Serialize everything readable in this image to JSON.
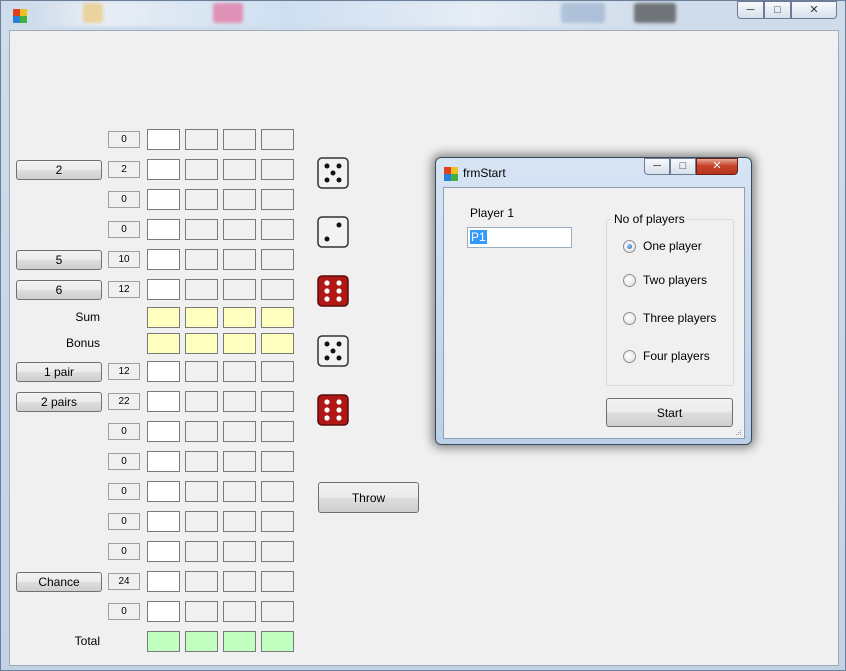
{
  "main": {
    "app_icon": "app-icon",
    "controls": {
      "minimize": "minimize-icon",
      "maximize": "maximize-icon",
      "close": "close-icon"
    }
  },
  "scorecard": {
    "rows": [
      {
        "button": null,
        "label": null,
        "value": "0",
        "cell_style": "plain"
      },
      {
        "button": "2",
        "label": null,
        "value": "2",
        "cell_style": "plain"
      },
      {
        "button": null,
        "label": null,
        "value": "0",
        "cell_style": "plain"
      },
      {
        "button": null,
        "label": null,
        "value": "0",
        "cell_style": "plain"
      },
      {
        "button": "5",
        "label": null,
        "value": "10",
        "cell_style": "plain"
      },
      {
        "button": "6",
        "label": null,
        "value": "12",
        "cell_style": "plain"
      },
      {
        "button": null,
        "label": "Sum",
        "value": null,
        "cell_style": "yellow"
      },
      {
        "button": null,
        "label": "Bonus",
        "value": null,
        "cell_style": "yellow"
      },
      {
        "button": "1 pair",
        "label": null,
        "value": "12",
        "cell_style": "plain"
      },
      {
        "button": "2 pairs",
        "label": null,
        "value": "22",
        "cell_style": "plain"
      },
      {
        "button": null,
        "label": null,
        "value": "0",
        "cell_style": "plain"
      },
      {
        "button": null,
        "label": null,
        "value": "0",
        "cell_style": "plain"
      },
      {
        "button": null,
        "label": null,
        "value": "0",
        "cell_style": "plain"
      },
      {
        "button": null,
        "label": null,
        "value": "0",
        "cell_style": "plain"
      },
      {
        "button": null,
        "label": null,
        "value": "0",
        "cell_style": "plain"
      },
      {
        "button": "Chance",
        "label": null,
        "value": "24",
        "cell_style": "plain"
      },
      {
        "button": null,
        "label": null,
        "value": "0",
        "cell_style": "plain"
      },
      {
        "button": null,
        "label": "Total",
        "value": null,
        "cell_style": "green"
      }
    ]
  },
  "dice": [
    {
      "face": 5,
      "held": false
    },
    {
      "face": 2,
      "held": false
    },
    {
      "face": 6,
      "held": true
    },
    {
      "face": 5,
      "held": false
    },
    {
      "face": 6,
      "held": true
    }
  ],
  "colors": {
    "yellow_cell": "#ffffc0",
    "green_cell": "#c0ffc0",
    "held_die": "#b01818"
  },
  "throw_label": "Throw",
  "dialog": {
    "title": "frmStart",
    "player_label": "Player 1",
    "player_value": "P1",
    "group_title": "No of players",
    "options": [
      "One player",
      "Two players",
      "Three players",
      "Four players"
    ],
    "selected": "One player",
    "start_label": "Start"
  }
}
